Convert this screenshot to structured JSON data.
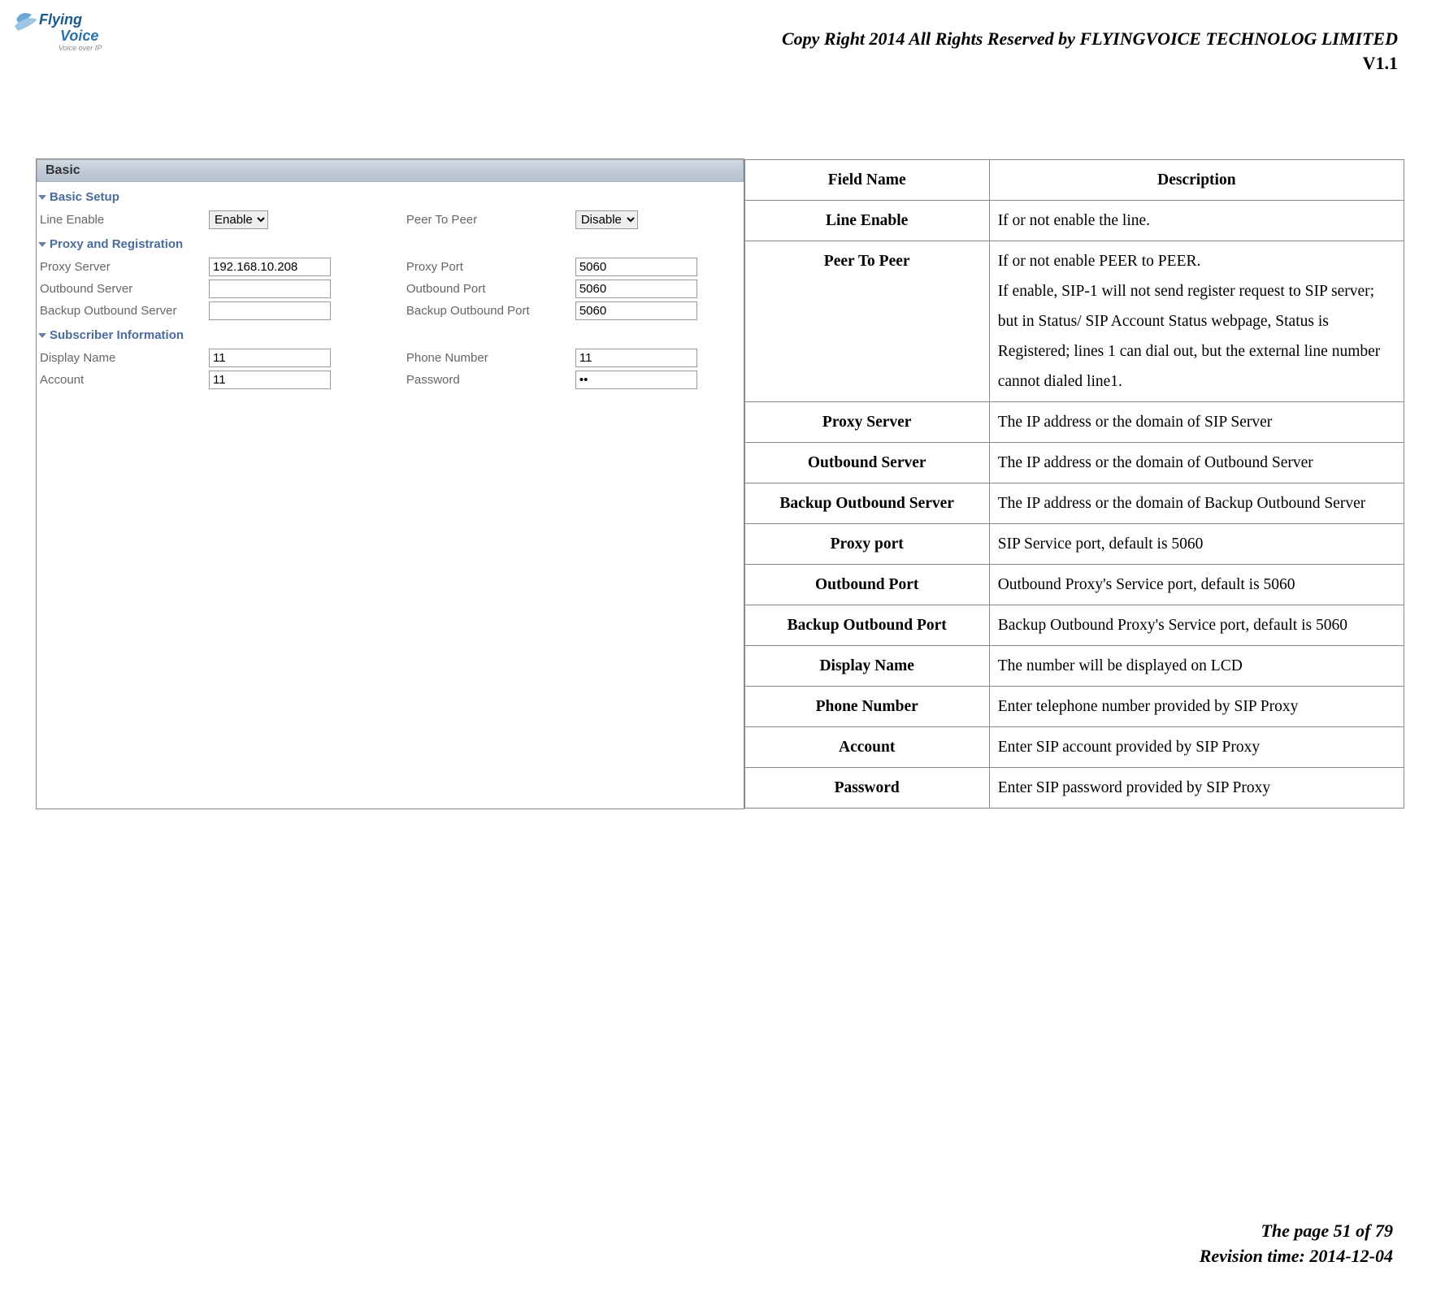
{
  "header": {
    "copyright": "Copy Right 2014 All Rights Reserved by FLYINGVOICE TECHNOLOG LIMITED",
    "version": "V1.1",
    "logo_tagline": "Voice over IP"
  },
  "footer": {
    "page_line": "The page 51 of 79",
    "revision_line": "Revision time: 2014-12-04"
  },
  "screenshot": {
    "panel_title": "Basic",
    "sections": {
      "basic_setup": "Basic Setup",
      "proxy_reg": "Proxy and Registration",
      "subscriber": "Subscriber Information"
    },
    "labels": {
      "line_enable": "Line Enable",
      "peer_to_peer": "Peer To Peer",
      "proxy_server": "Proxy Server",
      "proxy_port": "Proxy Port",
      "outbound_server": "Outbound Server",
      "outbound_port": "Outbound Port",
      "backup_outbound_server": "Backup Outbound Server",
      "backup_outbound_port": "Backup Outbound Port",
      "display_name": "Display Name",
      "phone_number": "Phone Number",
      "account": "Account",
      "password": "Password"
    },
    "values": {
      "line_enable": "Enable",
      "peer_to_peer": "Disable",
      "proxy_server": "192.168.10.208",
      "proxy_port": "5060",
      "outbound_server": "",
      "outbound_port": "5060",
      "backup_outbound_server": "",
      "backup_outbound_port": "5060",
      "display_name": "11",
      "phone_number": "11",
      "account": "11",
      "password": "••"
    }
  },
  "table": {
    "header": {
      "field": "Field Name",
      "desc": "Description"
    },
    "rows": [
      {
        "field": "Line Enable",
        "desc": "If or not enable the line."
      },
      {
        "field": "Peer To Peer",
        "desc": "If or not enable PEER to PEER.\nIf enable, SIP-1 will not send register request to SIP server; but in Status/ SIP Account Status webpage, Status is Registered; lines 1 can dial out, but the external line number cannot dialed line1."
      },
      {
        "field": "Proxy Server",
        "desc": "The IP address or the domain of SIP Server"
      },
      {
        "field": "Outbound Server",
        "desc": "The IP address or the domain of Outbound Server"
      },
      {
        "field": "Backup Outbound Server",
        "desc": "The IP address or the domain of Backup Outbound Server"
      },
      {
        "field": "Proxy port",
        "desc": "SIP Service port, default is 5060"
      },
      {
        "field": "Outbound Port",
        "desc": "Outbound Proxy's Service port, default is 5060"
      },
      {
        "field": "Backup Outbound Port",
        "desc": "Backup Outbound Proxy's Service port, default is 5060"
      },
      {
        "field": "Display Name",
        "desc": "The number will be displayed on LCD"
      },
      {
        "field": "Phone Number",
        "desc": "Enter telephone number provided by SIP Proxy"
      },
      {
        "field": "Account",
        "desc": "Enter SIP account provided by SIP Proxy"
      },
      {
        "field": "Password",
        "desc": "Enter SIP password provided by SIP Proxy"
      }
    ]
  }
}
